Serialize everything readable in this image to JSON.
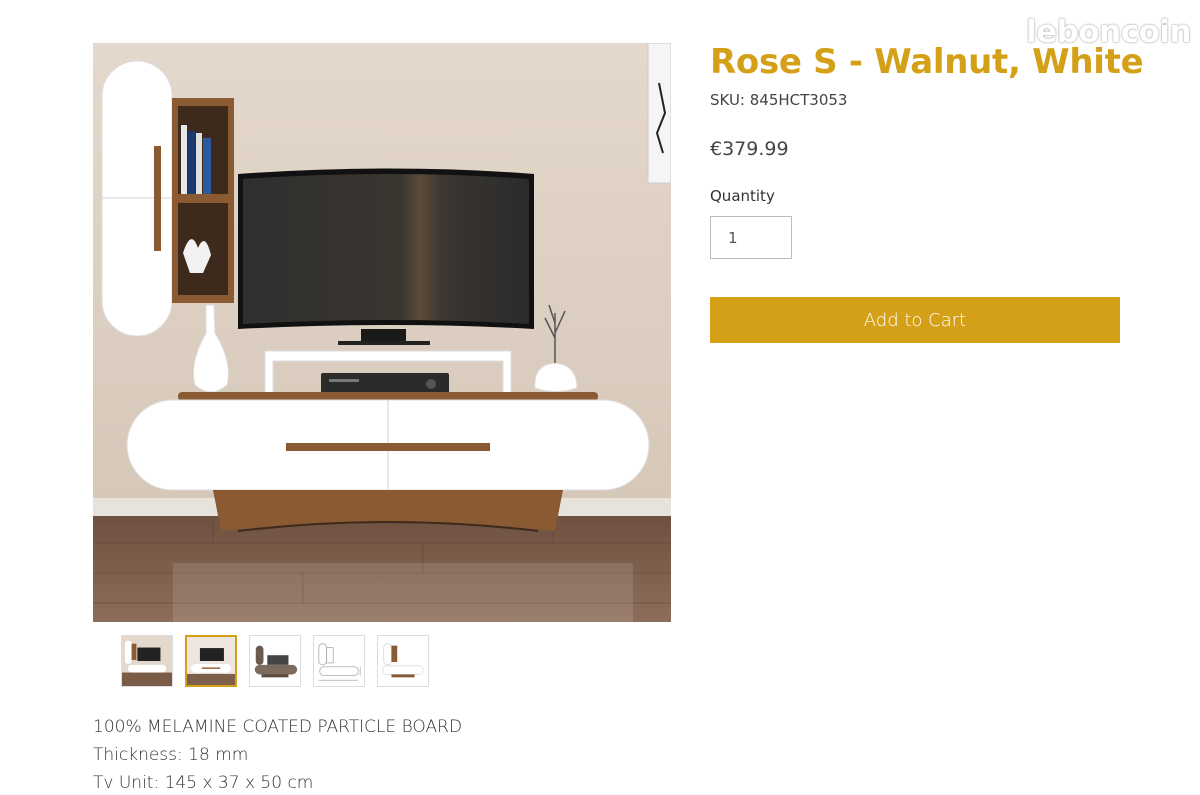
{
  "watermark": "leboncoin",
  "product": {
    "title": "Rose S - Walnut, White",
    "sku": "SKU: 845HCT3053",
    "price": "€379.99",
    "quantity_label": "Quantity",
    "quantity_value": "1",
    "add_to_cart_label": "Add to Cart"
  },
  "description": [
    "100% MELAMINE COATED PARTICLE BOARD",
    "Thickness: 18 mm",
    "Tv Unit: 145 x 37 x 50 cm"
  ],
  "thumbnails": {
    "count": 5,
    "selected_index": 1
  },
  "colors": {
    "accent": "#d4a017",
    "walnut": "#8a5a32",
    "white": "#ffffff"
  }
}
